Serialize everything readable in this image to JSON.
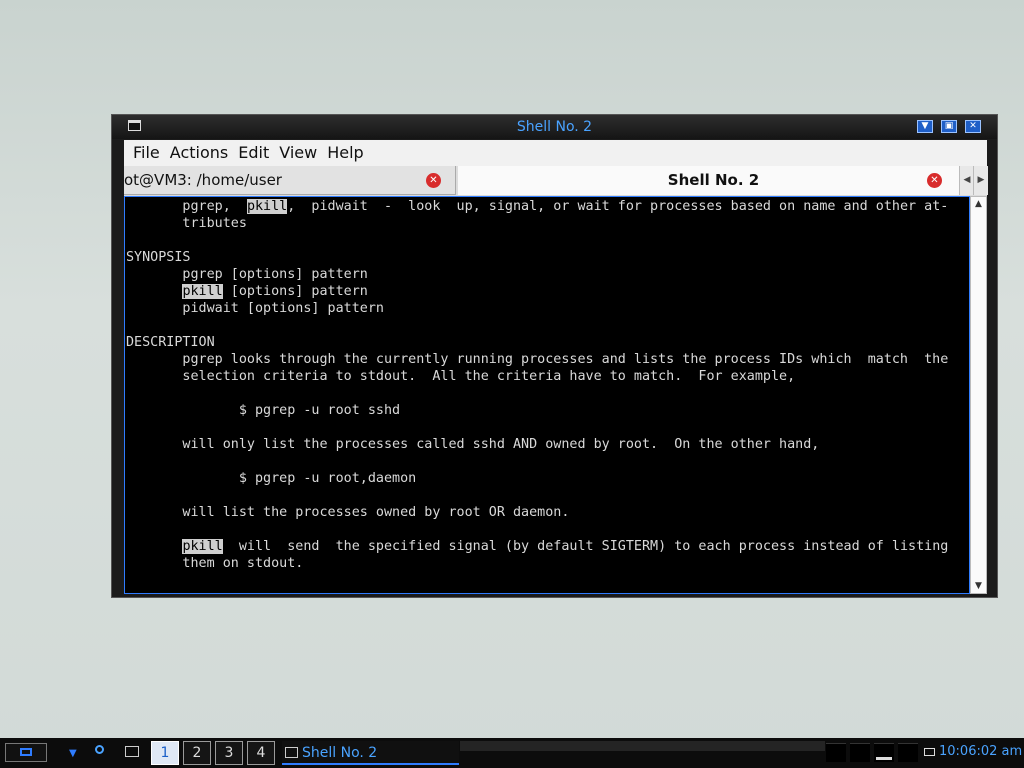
{
  "window": {
    "title": "Shell No. 2"
  },
  "menu": [
    "File",
    "Actions",
    "Edit",
    "View",
    "Help"
  ],
  "tabs": [
    {
      "label": "ot@VM3: /home/user"
    },
    {
      "label": "Shell No. 2"
    }
  ],
  "terminal": {
    "lines": [
      [
        {
          "t": "       pgrep,  "
        },
        {
          "t": "pkill",
          "h": true
        },
        {
          "t": ",  pidwait  -  look  up, signal, or wait for processes based on name and other at-"
        }
      ],
      [
        {
          "t": "       tributes"
        }
      ],
      [
        {
          "t": ""
        }
      ],
      [
        {
          "t": "SYNOPSIS"
        }
      ],
      [
        {
          "t": "       pgrep [options] pattern"
        }
      ],
      [
        {
          "t": "       "
        },
        {
          "t": "pkill",
          "h": true
        },
        {
          "t": " [options] pattern"
        }
      ],
      [
        {
          "t": "       pidwait [options] pattern"
        }
      ],
      [
        {
          "t": ""
        }
      ],
      [
        {
          "t": "DESCRIPTION"
        }
      ],
      [
        {
          "t": "       pgrep looks through the currently running processes and lists the process IDs which  match  the"
        }
      ],
      [
        {
          "t": "       selection criteria to stdout.  All the criteria have to match.  For example,"
        }
      ],
      [
        {
          "t": ""
        }
      ],
      [
        {
          "t": "              $ pgrep -u root sshd"
        }
      ],
      [
        {
          "t": ""
        }
      ],
      [
        {
          "t": "       will only list the processes called sshd AND owned by root.  On the other hand,"
        }
      ],
      [
        {
          "t": ""
        }
      ],
      [
        {
          "t": "              $ pgrep -u root,daemon"
        }
      ],
      [
        {
          "t": ""
        }
      ],
      [
        {
          "t": "       will list the processes owned by root OR daemon."
        }
      ],
      [
        {
          "t": ""
        }
      ],
      [
        {
          "t": "       "
        },
        {
          "t": "pkill",
          "h": true
        },
        {
          "t": "  will  send  the specified signal (by default SIGTERM) to each process instead of listing"
        }
      ],
      [
        {
          "t": "       them on stdout."
        }
      ],
      [
        {
          "t": ""
        }
      ],
      [
        {
          "t": ":_"
        }
      ]
    ]
  },
  "taskbar": {
    "desktops": [
      "1",
      "2",
      "3",
      "4"
    ],
    "active_desktop": 0,
    "task_label": "Shell No. 2",
    "clock": "10:06:02  am"
  },
  "colors": {
    "accent": "#4aa3ff",
    "terminal_bg": "#000000",
    "terminal_fg": "#d9d9d9",
    "highlight_bg": "#cfcfcf"
  }
}
